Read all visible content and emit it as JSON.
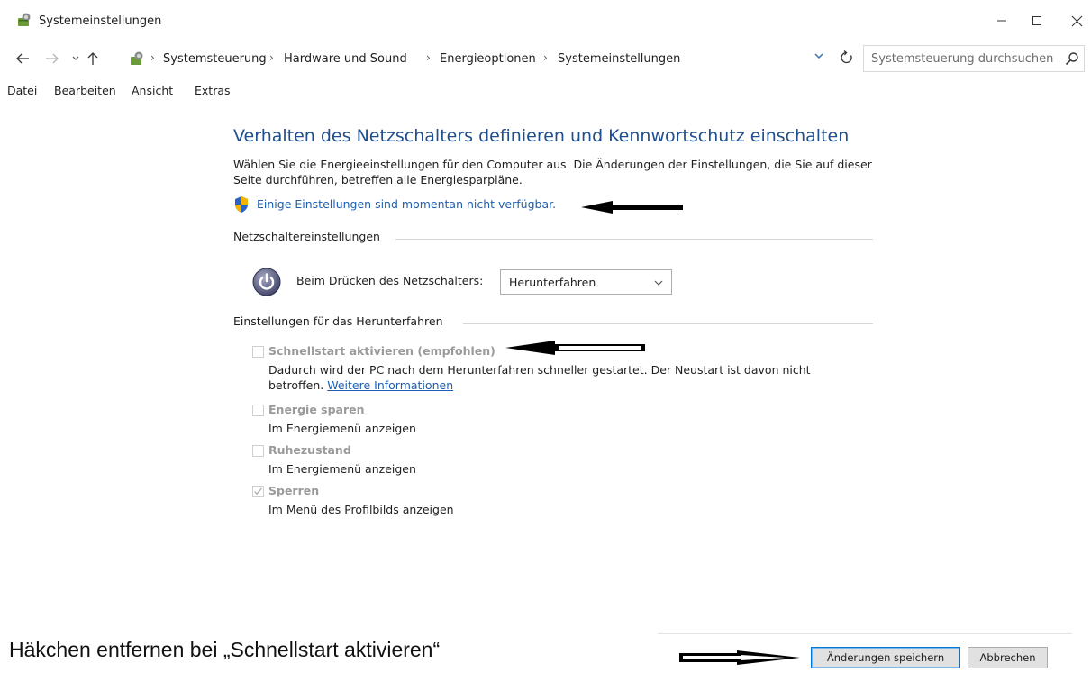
{
  "window": {
    "title": "Systemeinstellungen",
    "icon": "control-panel-icon"
  },
  "address": {
    "breadcrumbs": [
      "Systemsteuerung",
      "Hardware und Sound",
      "Energieoptionen",
      "Systemeinstellungen"
    ],
    "search_placeholder": "Systemsteuerung durchsuchen"
  },
  "menu": {
    "items": [
      "Datei",
      "Bearbeiten",
      "Ansicht",
      "Extras"
    ]
  },
  "main": {
    "heading": "Verhalten des Netzschalters definieren und Kennwortschutz einschalten",
    "description": "Wählen Sie die Energieeinstellungen für den Computer aus. Die Änderungen der Einstellungen, die Sie auf dieser Seite durchführen, betreffen alle Energiesparpläne.",
    "shield_link": "Einige Einstellungen sind momentan nicht verfügbar.",
    "power_section": {
      "label": "Netzschaltereinstellungen",
      "power_button_label": "Beim Drücken des Netzschalters:",
      "power_button_value": "Herunterfahren"
    },
    "shutdown_section": {
      "label": "Einstellungen für das Herunterfahren",
      "options": [
        {
          "title": "Schnellstart aktivieren (empfohlen)",
          "checked": false,
          "desc_text": "Dadurch wird der PC nach dem Herunterfahren schneller gestartet. Der Neustart ist davon nicht betroffen.",
          "desc_link": "Weitere Informationen"
        },
        {
          "title": "Energie sparen",
          "checked": false,
          "desc_text": "Im Energiemenü anzeigen"
        },
        {
          "title": "Ruhezustand",
          "checked": false,
          "desc_text": "Im Energiemenü anzeigen"
        },
        {
          "title": "Sperren",
          "checked": true,
          "desc_text": "Im Menü des Profilbilds anzeigen"
        }
      ]
    }
  },
  "footer": {
    "save_label": "Änderungen speichern",
    "cancel_label": "Abbrechen"
  },
  "annotation": {
    "caption": "Häkchen entfernen bei „Schnellstart aktivieren“"
  },
  "colors": {
    "heading": "#1f4e8c",
    "link": "#1e5fb3",
    "disabled_text": "#9a9a9a",
    "primary_button_border": "#0078d7"
  }
}
